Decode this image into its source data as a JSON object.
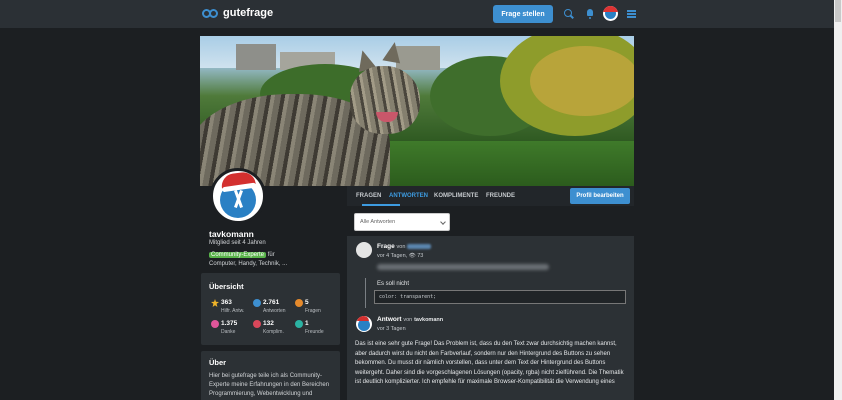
{
  "header": {
    "logo": "gutefrage",
    "ask_button": "Frage stellen",
    "icons": [
      "search-icon",
      "bell-icon",
      "avatar",
      "menu-icon"
    ]
  },
  "colors": {
    "accent": "#3d8fd0",
    "expert_badge": "#59b34a",
    "background": "#1c1f22",
    "card": "#2c3135"
  },
  "profile": {
    "username": "tavkomann",
    "member_since": "Mitglied seit 4 Jahren",
    "badge": "Community-Experte",
    "badge_suffix": "für",
    "topics": "Computer, Handy, Technik, ..."
  },
  "overview": {
    "title": "Übersicht",
    "stats": [
      {
        "value": "363",
        "label": "Hilfr. Antw.",
        "icon": "star-icon",
        "color": "#f0b429"
      },
      {
        "value": "2.761",
        "label": "Antworten",
        "icon": "speech-bubble-icon",
        "color": "#3d8fd0"
      },
      {
        "value": "5",
        "label": "Fragen",
        "icon": "question-icon",
        "color": "#e58a2c"
      },
      {
        "value": "1.375",
        "label": "Danke",
        "icon": "heart-icon",
        "color": "#e0569a"
      },
      {
        "value": "132",
        "label": "Komplim.",
        "icon": "badge-icon",
        "color": "#d9475a"
      },
      {
        "value": "1",
        "label": "Freunde",
        "icon": "friends-icon",
        "color": "#2bb3a3"
      }
    ]
  },
  "about": {
    "title": "Über",
    "text": "Hier bei gutefrage teile ich als Community-Experte meine Erfahrungen in den Bereichen Programmierung, Webentwicklung und"
  },
  "tabs": [
    {
      "label": "FRAGEN",
      "active": false
    },
    {
      "label": "ANTWORTEN",
      "active": true
    },
    {
      "label": "KOMPLIMENTE",
      "active": false
    },
    {
      "label": "FREUNDE",
      "active": false
    }
  ],
  "edit_profile": "Profil bearbeiten",
  "filter": {
    "selected": "Alle Antworten"
  },
  "question": {
    "type": "Frage",
    "von": "von",
    "meta": "vor 4 Tagen, 👁 73",
    "body": "Es soll nicht",
    "code": "color: transparent;"
  },
  "answer": {
    "type": "Antwort",
    "von": "von",
    "author": "tavkomann",
    "meta": "vor 3 Tagen",
    "body": "Das ist eine sehr gute Frage! Das Problem ist, dass du den Text zwar durchsichtig machen kannst, aber dadurch wirst du nicht den Farbverlauf, sondern nur den Hintergrund des Buttons zu sehen bekommen. Du musst dir nämlich vorstellen, dass unter dem Text der Hintergrund des Buttons weitergeht. Daher sind die vorgeschlagenen Lösungen (opacity, rgba) nicht zielführend. Die Thematik ist deutlich komplizierter. Ich empfehle für maximale Browser-Kompatibilität die Verwendung eines"
  }
}
